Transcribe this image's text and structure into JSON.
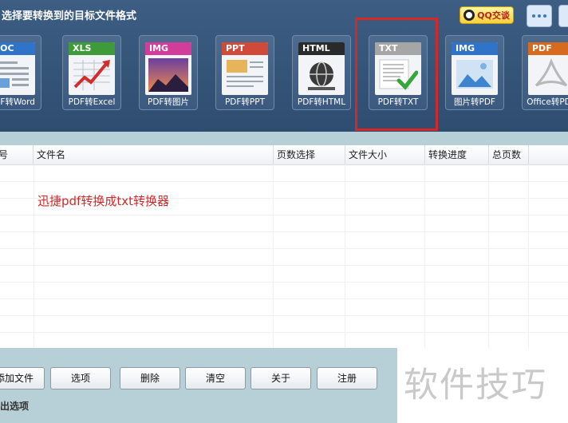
{
  "header": {
    "title": "选择要转换到的目标文件格式",
    "qq_label": "QQ交谈",
    "chat_icon": "chat-bubble-icon"
  },
  "formats": [
    {
      "tag": "DOC",
      "label": "PDF转Word",
      "color": "#2f74c9",
      "icon": "doc-icon"
    },
    {
      "tag": "XLS",
      "label": "PDF转Excel",
      "color": "#3f9b3a",
      "icon": "xls-chart-icon"
    },
    {
      "tag": "IMG",
      "label": "PDF转图片",
      "color": "#d23d9b",
      "icon": "image-icon"
    },
    {
      "tag": "PPT",
      "label": "PDF转PPT",
      "color": "#d04a3a",
      "icon": "ppt-icon"
    },
    {
      "tag": "HTML",
      "label": "PDF转HTML",
      "color": "#2a2a2a",
      "icon": "html-globe-icon"
    },
    {
      "tag": "TXT",
      "label": "PDF转TXT",
      "color": "#a6a6a6",
      "icon": "txt-check-icon"
    },
    {
      "tag": "IMG",
      "label": "图片转PDF",
      "color": "#2f74c9",
      "icon": "image-to-pdf-icon"
    },
    {
      "tag": "PDF",
      "label": "Office转PDF",
      "color": "#d66b1f",
      "icon": "pdf-acrobat-icon"
    }
  ],
  "table": {
    "columns": [
      "号",
      "文件名",
      "页数选择",
      "文件大小",
      "转换进度",
      "总页数"
    ],
    "rows": [
      {
        "filename": "迅捷pdf转换成txt转换器"
      }
    ]
  },
  "actions": {
    "add_file": "添加文件",
    "options": "选项",
    "delete": "删除",
    "clear": "清空",
    "about": "关于",
    "register": "注册"
  },
  "output_label": "出选项",
  "watermark": "软件技巧",
  "colors": {
    "topbar": "#365679",
    "highlight": "#d42727",
    "panel": "#b7cfd6"
  }
}
